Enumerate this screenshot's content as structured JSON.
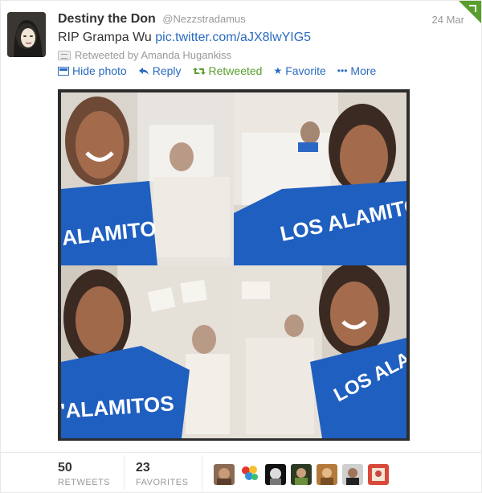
{
  "tweet": {
    "fullname": "Destiny the Don",
    "username": "@Nezzstradamus",
    "time": "24 Mar",
    "text": "RIP Grampa Wu ",
    "link": "pic.twitter.com/aJX8lwYIG5",
    "retweeted_by": "Retweeted by Amanda Hugankiss"
  },
  "actions": {
    "hide_photo": "Hide photo",
    "reply": "Reply",
    "retweeted": "Retweeted",
    "favorite": "Favorite",
    "more": "More"
  },
  "stats": {
    "retweets_count": "50",
    "retweets_label": "RETWEETS",
    "favorites_count": "23",
    "favorites_label": "FAVORITES"
  },
  "icons": {
    "hide_photo": "photo-icon",
    "reply": "reply-arrow-icon",
    "retweet": "retweet-icon",
    "favorite": "star-icon",
    "more": "ellipsis-icon",
    "corner": "retweeted-corner-icon"
  },
  "colors": {
    "link": "#2a6bbf",
    "retweet_active": "#5a9e2f",
    "muted": "#999999",
    "jersey_blue": "#1f5fbf"
  }
}
